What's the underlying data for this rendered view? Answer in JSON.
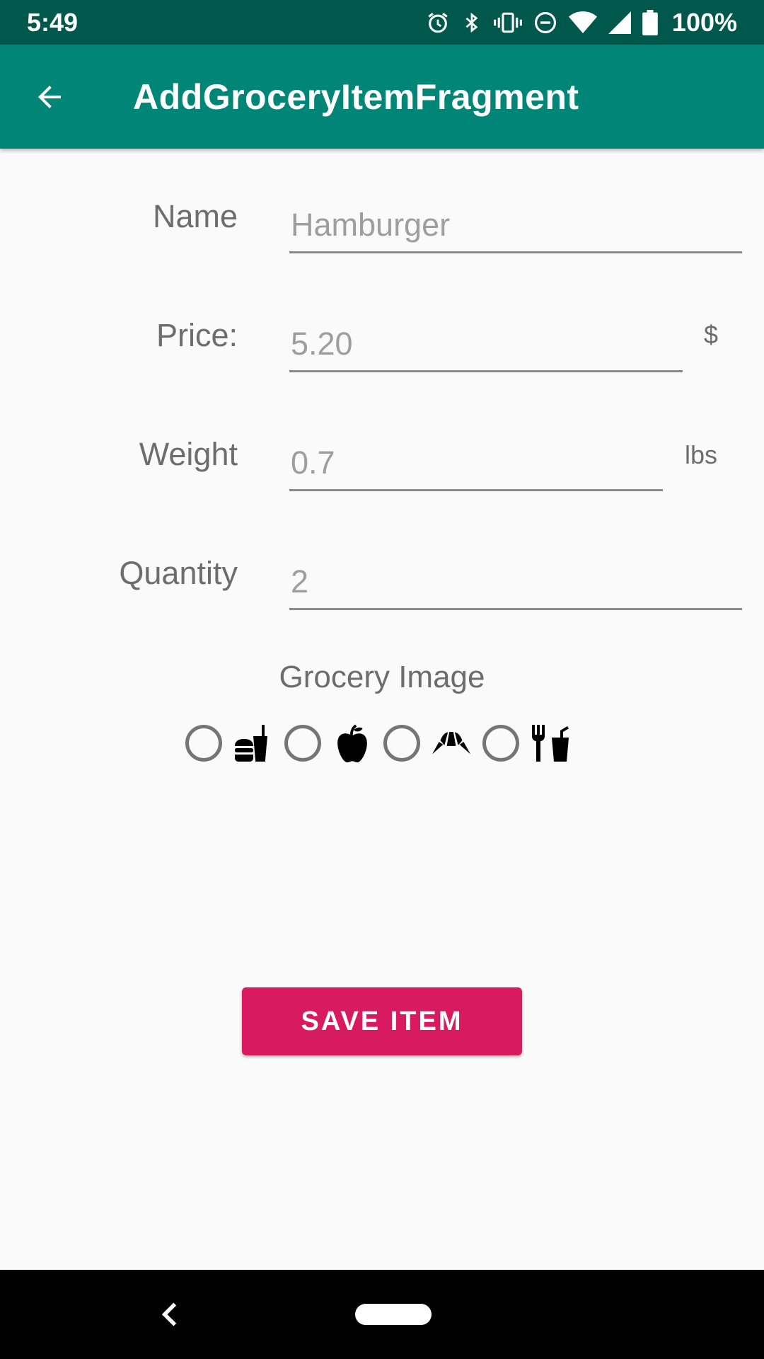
{
  "status_bar": {
    "time": "5:49",
    "battery": "100%",
    "icons": [
      "alarm-icon",
      "bluetooth-icon",
      "vibrate-icon",
      "do-not-disturb-icon",
      "wifi-icon",
      "signal-icon",
      "battery-icon"
    ]
  },
  "app_bar": {
    "title": "AddGroceryItemFragment",
    "nav_icon": "back-arrow-icon",
    "color": "#008577"
  },
  "form": {
    "name": {
      "label": "Name",
      "value": "Hamburger"
    },
    "price": {
      "label": "Price:",
      "value": "5.20",
      "unit": "$"
    },
    "weight": {
      "label": "Weight",
      "value": "0.7",
      "unit": "lbs"
    },
    "quantity": {
      "label": "Quantity",
      "value": "2"
    }
  },
  "grocery_image": {
    "title": "Grocery Image",
    "options": [
      {
        "icon": "fastfood-icon",
        "selected": false
      },
      {
        "icon": "apple-icon",
        "selected": false
      },
      {
        "icon": "croissant-icon",
        "selected": false
      },
      {
        "icon": "restaurant-icon",
        "selected": false
      }
    ]
  },
  "save_button": {
    "label": "SAVE ITEM",
    "color": "#d81b60"
  }
}
